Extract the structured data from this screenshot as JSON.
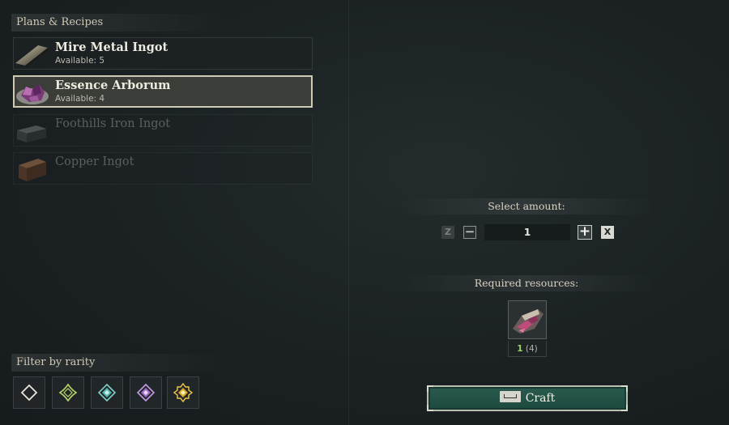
{
  "plans": {
    "title": "Plans & Recipes",
    "recipes": [
      {
        "name": "Mire Metal Ingot",
        "available": "Available: 5",
        "state": "normal",
        "icon": "mire-metal-ingot-icon"
      },
      {
        "name": "Essence Arborum",
        "available": "Available: 4",
        "state": "selected",
        "icon": "essence-arborum-icon"
      },
      {
        "name": "Foothills Iron Ingot",
        "available": "",
        "state": "disabled",
        "icon": "iron-ingot-icon"
      },
      {
        "name": "Copper Ingot",
        "available": "",
        "state": "disabled",
        "icon": "copper-ingot-icon"
      }
    ]
  },
  "filter": {
    "title": "Filter by rarity",
    "rarities": [
      {
        "icon": "common-rarity-icon",
        "color": "#e8e6dc"
      },
      {
        "icon": "uncommon-rarity-icon",
        "color": "#b8d86a"
      },
      {
        "icon": "rare-rarity-icon",
        "color": "#7fd0c8"
      },
      {
        "icon": "epic-rarity-icon",
        "color": "#c79ae8"
      },
      {
        "icon": "legendary-rarity-icon",
        "color": "#f2c94c"
      }
    ]
  },
  "amount": {
    "title": "Select amount:",
    "decrease_key": "Z",
    "increase_key": "X",
    "minus_symbol": "−",
    "plus_symbol": "+",
    "value": "1"
  },
  "resources": {
    "title": "Required resources:",
    "items": [
      {
        "icon": "essence-arborum-resource-icon",
        "required": "1",
        "have": "(4)"
      }
    ]
  },
  "craft": {
    "label": "Craft",
    "key_icon": "spacebar-key-icon",
    "accent": "#1f4d42"
  }
}
